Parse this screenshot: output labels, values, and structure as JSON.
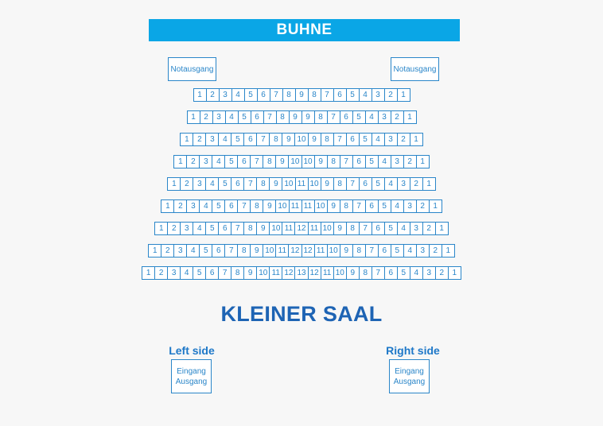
{
  "stage": {
    "label": "BUHNE"
  },
  "exits": {
    "left": "Notausgang",
    "right": "Notausgang"
  },
  "hall_title": "KLEINER SAAL",
  "sides": {
    "left": {
      "label": "Left side",
      "door_line1": "Eingang",
      "door_line2": "Ausgang"
    },
    "right": {
      "label": "Right side",
      "door_line1": "Eingang",
      "door_line2": "Ausgang"
    }
  },
  "rows": [
    [
      "1",
      "2",
      "3",
      "4",
      "5",
      "6",
      "7",
      "8",
      "9",
      "8",
      "7",
      "6",
      "5",
      "4",
      "3",
      "2",
      "1"
    ],
    [
      "1",
      "2",
      "3",
      "4",
      "5",
      "6",
      "7",
      "8",
      "9",
      "9",
      "8",
      "7",
      "6",
      "5",
      "4",
      "3",
      "2",
      "1"
    ],
    [
      "1",
      "2",
      "3",
      "4",
      "5",
      "6",
      "7",
      "8",
      "9",
      "10",
      "9",
      "8",
      "7",
      "6",
      "5",
      "4",
      "3",
      "2",
      "1"
    ],
    [
      "1",
      "2",
      "3",
      "4",
      "5",
      "6",
      "7",
      "8",
      "9",
      "10",
      "10",
      "9",
      "8",
      "7",
      "6",
      "5",
      "4",
      "3",
      "2",
      "1"
    ],
    [
      "1",
      "2",
      "3",
      "4",
      "5",
      "6",
      "7",
      "8",
      "9",
      "10",
      "11",
      "10",
      "9",
      "8",
      "7",
      "6",
      "5",
      "4",
      "3",
      "2",
      "1"
    ],
    [
      "1",
      "2",
      "3",
      "4",
      "5",
      "6",
      "7",
      "8",
      "9",
      "10",
      "11",
      "11",
      "10",
      "9",
      "8",
      "7",
      "6",
      "5",
      "4",
      "3",
      "2",
      "1"
    ],
    [
      "1",
      "2",
      "3",
      "4",
      "5",
      "6",
      "7",
      "8",
      "9",
      "10",
      "11",
      "12",
      "11",
      "10",
      "9",
      "8",
      "7",
      "6",
      "5",
      "4",
      "3",
      "2",
      "1"
    ],
    [
      "1",
      "2",
      "3",
      "4",
      "5",
      "6",
      "7",
      "8",
      "9",
      "10",
      "11",
      "12",
      "12",
      "11",
      "10",
      "9",
      "8",
      "7",
      "6",
      "5",
      "4",
      "3",
      "2",
      "1"
    ],
    [
      "1",
      "2",
      "3",
      "4",
      "5",
      "6",
      "7",
      "8",
      "9",
      "10",
      "11",
      "12",
      "13",
      "12",
      "11",
      "10",
      "9",
      "8",
      "7",
      "6",
      "5",
      "4",
      "3",
      "2",
      "1"
    ]
  ],
  "colors": {
    "stage": "#0aa6e6",
    "seat_border": "#2a86c9",
    "title": "#1e64b4"
  }
}
